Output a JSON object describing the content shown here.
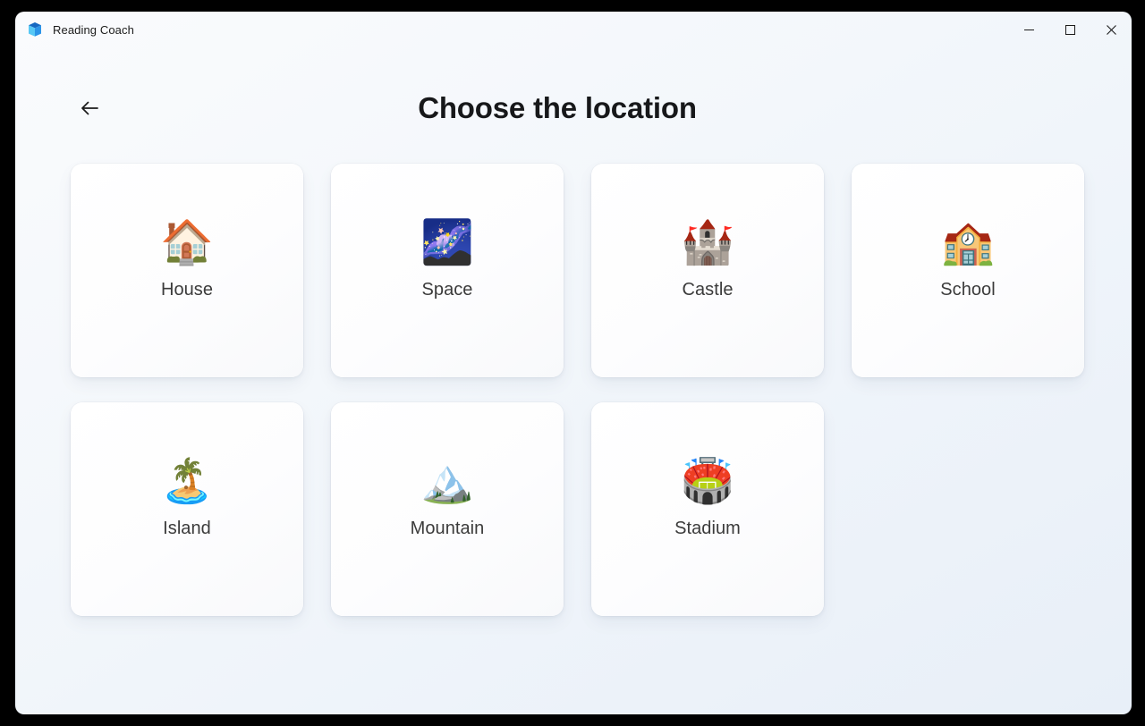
{
  "window": {
    "app_title": "Reading Coach",
    "app_icon": "reading-coach-cube-icon",
    "controls": {
      "minimize_label": "Minimize",
      "maximize_label": "Maximize",
      "close_label": "Close"
    }
  },
  "header": {
    "back_icon": "arrow-left-icon",
    "back_label": "Back",
    "title": "Choose the location"
  },
  "locations": [
    {
      "label": "House",
      "emoji": "🏠",
      "icon_name": "house-emoji-icon"
    },
    {
      "label": "Space",
      "emoji": "🌌",
      "icon_name": "milky-way-emoji-icon"
    },
    {
      "label": "Castle",
      "emoji": "🏰",
      "icon_name": "castle-emoji-icon"
    },
    {
      "label": "School",
      "emoji": "🏫",
      "icon_name": "school-emoji-icon"
    },
    {
      "label": "Island",
      "emoji": "🏝️",
      "icon_name": "island-emoji-icon"
    },
    {
      "label": "Mountain",
      "emoji": "🏔️",
      "icon_name": "mountain-emoji-icon"
    },
    {
      "label": "Stadium",
      "emoji": "🏟️",
      "icon_name": "stadium-emoji-icon"
    }
  ],
  "colors": {
    "page_background_top": "#fafbfd",
    "page_background_bottom": "#e8eff8",
    "card_background": "#ffffff",
    "title_text": "#17181a",
    "label_text": "#3b3b3b",
    "accent_blue": "#2f9ce8",
    "desktop_background": "#000000"
  }
}
